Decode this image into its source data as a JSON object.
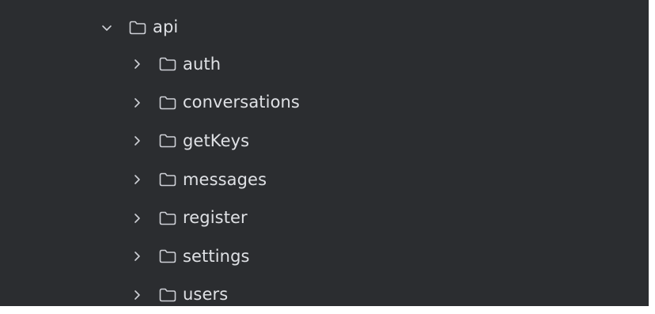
{
  "project_tree": {
    "root": {
      "label": "api",
      "expanded": true,
      "icon": "folder-icon",
      "expander_icon": "chevron-down-icon"
    },
    "children": [
      {
        "label": "auth",
        "expanded": false,
        "icon": "folder-icon",
        "expander_icon": "chevron-right-icon"
      },
      {
        "label": "conversations",
        "expanded": false,
        "icon": "folder-icon",
        "expander_icon": "chevron-right-icon"
      },
      {
        "label": "getKeys",
        "expanded": false,
        "icon": "folder-icon",
        "expander_icon": "chevron-right-icon"
      },
      {
        "label": "messages",
        "expanded": false,
        "icon": "folder-icon",
        "expander_icon": "chevron-right-icon"
      },
      {
        "label": "register",
        "expanded": false,
        "icon": "folder-icon",
        "expander_icon": "chevron-right-icon"
      },
      {
        "label": "settings",
        "expanded": false,
        "icon": "folder-icon",
        "expander_icon": "chevron-right-icon"
      },
      {
        "label": "users",
        "expanded": false,
        "icon": "folder-icon",
        "expander_icon": "chevron-right-icon"
      }
    ]
  },
  "colors": {
    "panel_background": "#2b2d30",
    "text": "#dfe1e5",
    "icon": "#ced0d6"
  }
}
